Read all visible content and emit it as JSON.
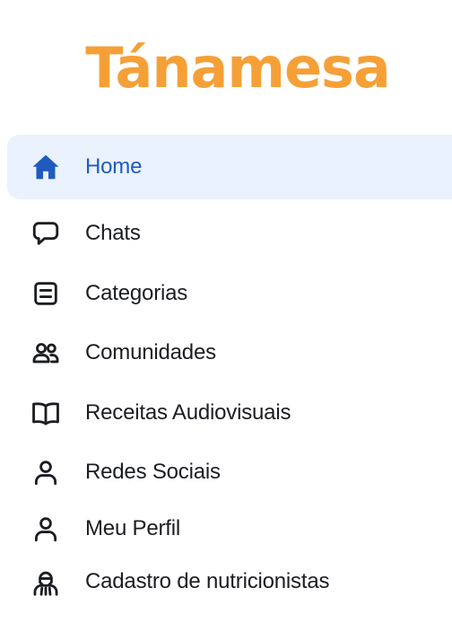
{
  "brand": {
    "title": "Tánamesa",
    "color": "#f5a037"
  },
  "theme": {
    "active_bg": "#eaf2fe",
    "active_color": "#1f5bbf",
    "text_color": "#1b1d22",
    "icon_color": "#1b1d22"
  },
  "sidebar": {
    "items": [
      {
        "label": "Home",
        "icon": "home-icon",
        "active": true
      },
      {
        "label": "Chats",
        "icon": "chat-bubble-icon",
        "active": false
      },
      {
        "label": "Categorias",
        "icon": "list-box-icon",
        "active": false
      },
      {
        "label": "Comunidades",
        "icon": "users-icon",
        "active": false
      },
      {
        "label": "Receitas Audiovisuais",
        "icon": "open-book-icon",
        "active": false
      },
      {
        "label": "Redes Sociais",
        "icon": "user-icon",
        "active": false
      },
      {
        "label": "Meu Perfil",
        "icon": "user-icon",
        "active": false
      },
      {
        "label": "Cadastro de nutricionistas",
        "icon": "nutritionist-icon",
        "active": false
      }
    ]
  }
}
